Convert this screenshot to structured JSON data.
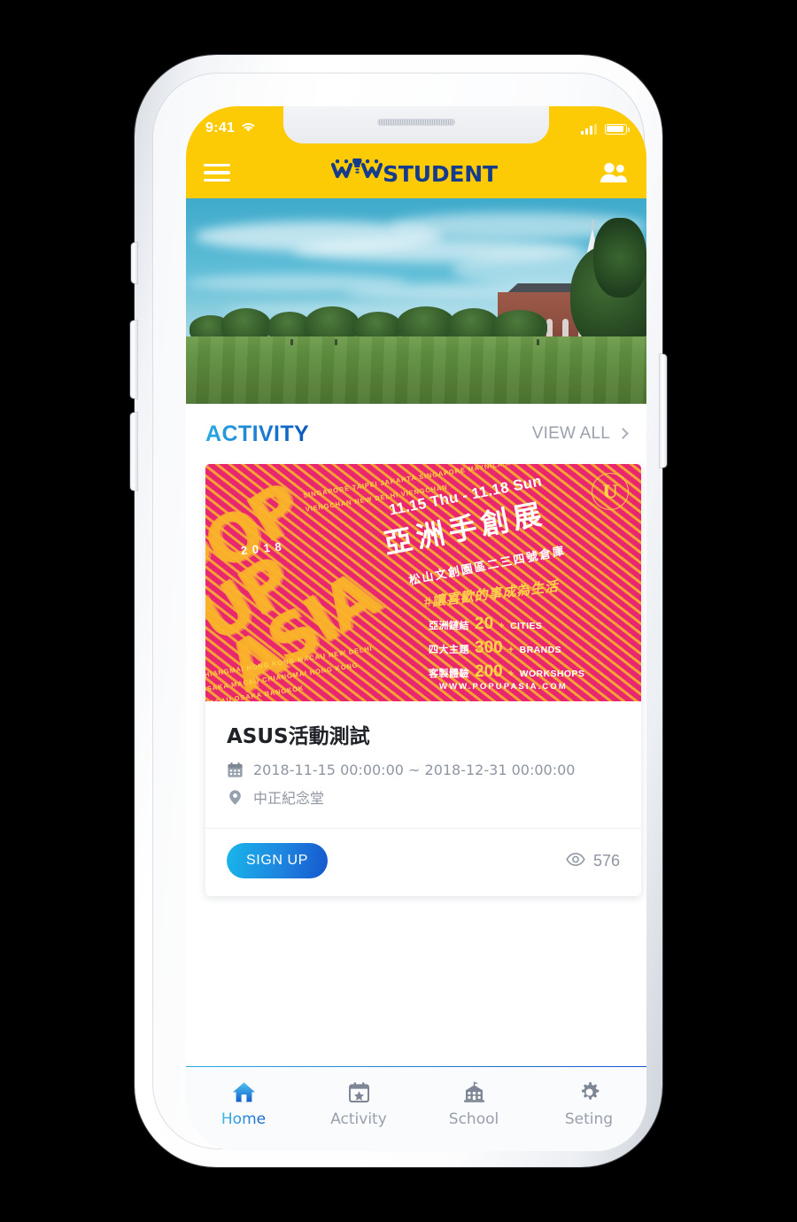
{
  "statusbar": {
    "time": "9:41",
    "wifi_icon": "wifi-icon",
    "signal_icon": "cellular-signal-icon",
    "battery_icon": "battery-icon"
  },
  "header": {
    "menu_icon": "hamburger-menu-icon",
    "logo_text": "WOWSTUDENT",
    "logo_prefix": "W",
    "logo_mid": "W",
    "logo_suffix": "STUDENT",
    "users_icon": "users-icon"
  },
  "hero": {
    "alt": "campus-lawn-with-chapel-photo"
  },
  "activity_section": {
    "title": "ACTIVITY",
    "view_all_label": "VIEW ALL",
    "chevron_icon": "chevron-right-icon"
  },
  "cards": [
    {
      "poster": {
        "brand_line1": "POP",
        "brand_line2": "UP",
        "brand_line3": "ASIA",
        "year": "2 0 1 8",
        "cities_top": "SINGAPORE  TAIPEI  JAKARTA  SINGAPORE   MAYNILA   MAYNILA   VIENGCHAN   NEW DELHI   VIENGCHAN",
        "cities_bottom": "CHIANGMAI HONG KONG  MACAU   NEW DELHI  OSAKA  MACAU   CHIANGMAI  HONG KONG   MACAU   OSAKA   BANGKOK",
        "date": "11.15 Thu - 11.18 Sun",
        "title_cn": "亞洲手創展",
        "venue_cn": "松山文創園區二三四號倉庫",
        "slogan": "#讓喜歡的事成為生活",
        "stats": [
          {
            "label_cn": "亞洲鏈結",
            "number": "20",
            "plus": "+",
            "unit": "CITIES"
          },
          {
            "label_cn": "四大主題",
            "number": "300",
            "plus": "+",
            "unit": "BRANDS"
          },
          {
            "label_cn": "客製體驗",
            "number": "200",
            "plus": "+",
            "unit": "WORKSHOPS"
          }
        ],
        "url": "WWW.POPUPASIA.COM",
        "stamp_icon": "circular-brand-stamp-icon"
      },
      "title": "ASUS活動測試",
      "calendar_icon": "calendar-icon",
      "date_range": "2018-11-15 00:00:00 ~ 2018-12-31 00:00:00",
      "location_icon": "location-pin-icon",
      "location": "中正紀念堂",
      "signup_label": "SIGN UP",
      "views_icon": "eye-icon",
      "views_count": "576"
    }
  ],
  "tabbar": {
    "items": [
      {
        "label": "Home",
        "icon": "home-icon",
        "active": true
      },
      {
        "label": "Activity",
        "icon": "calendar-star-icon",
        "active": false
      },
      {
        "label": "School",
        "icon": "school-building-icon",
        "active": false
      },
      {
        "label": "Seting",
        "icon": "gear-icon",
        "active": false
      }
    ]
  },
  "colors": {
    "brand_yellow": "#FDCB05",
    "brand_navy": "#153C8C",
    "accent_blue": "#1E87E0",
    "poster_pink": "#E8276F",
    "poster_yellow": "#FFD24A",
    "muted_gray": "#8E96A3"
  }
}
